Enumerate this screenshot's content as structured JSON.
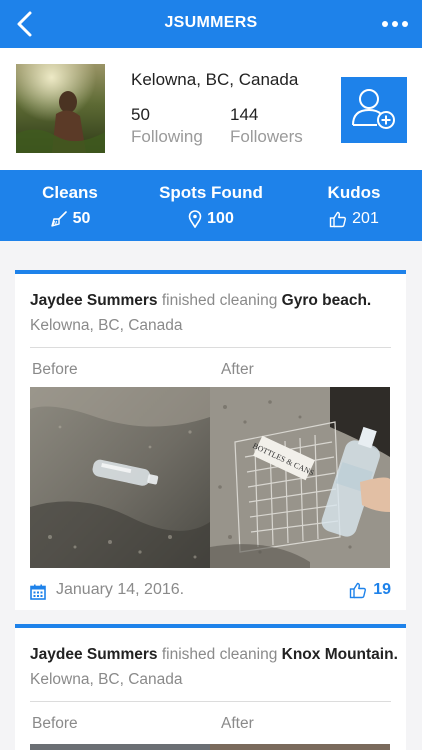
{
  "navbar": {
    "title": "JSUMMERS"
  },
  "profile": {
    "location": "Kelowna, BC, Canada",
    "following_count": "50",
    "following_label": "Following",
    "followers_count": "144",
    "followers_label": "Followers"
  },
  "stats": {
    "cleans_label": "Cleans",
    "cleans_value": "50",
    "spots_label": "Spots Found",
    "spots_value": "100",
    "kudos_label": "Kudos",
    "kudos_value": "201"
  },
  "feed": [
    {
      "user": "Jaydee Summers",
      "action": "finished cleaning",
      "place": "Gyro beach.",
      "location": "Kelowna, BC, Canada",
      "before_label": "Before",
      "after_label": "After",
      "date": "January 14, 2016.",
      "kudos": "19"
    },
    {
      "user": "Jaydee Summers",
      "action": "finished cleaning",
      "place": "Knox Mountain.",
      "location": "Kelowna, BC, Canada",
      "before_label": "Before",
      "after_label": "After"
    }
  ],
  "photo_sign_text": "BOTTLES & CANS",
  "colors": {
    "primary": "#1e82ea",
    "muted_text": "#8a8a8a",
    "background": "#f4f4f6"
  },
  "icons": [
    "back-chevron-icon",
    "more-dots-icon",
    "add-user-icon",
    "broom-icon",
    "map-pin-icon",
    "thumbs-up-icon",
    "calendar-icon"
  ]
}
